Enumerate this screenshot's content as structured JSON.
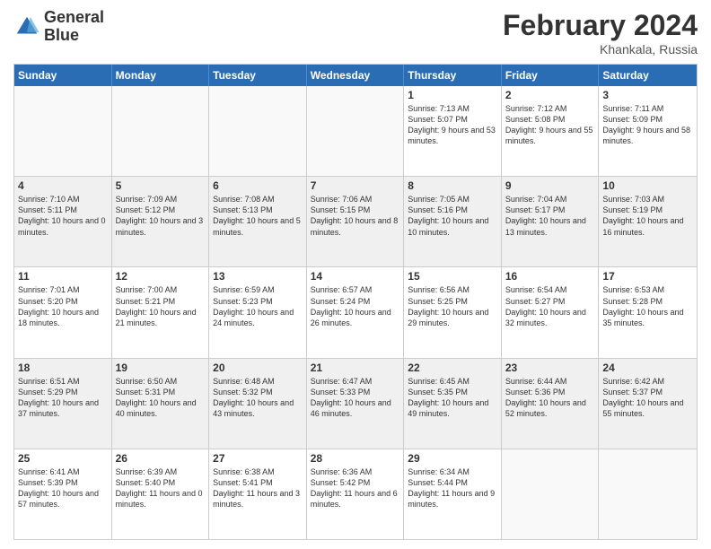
{
  "logo": {
    "line1": "General",
    "line2": "Blue"
  },
  "title": "February 2024",
  "location": "Khankala, Russia",
  "days_of_week": [
    "Sunday",
    "Monday",
    "Tuesday",
    "Wednesday",
    "Thursday",
    "Friday",
    "Saturday"
  ],
  "rows": [
    {
      "shaded": false,
      "cells": [
        {
          "day": "",
          "sunrise": "",
          "sunset": "",
          "daylight": "",
          "empty": true
        },
        {
          "day": "",
          "sunrise": "",
          "sunset": "",
          "daylight": "",
          "empty": true
        },
        {
          "day": "",
          "sunrise": "",
          "sunset": "",
          "daylight": "",
          "empty": true
        },
        {
          "day": "",
          "sunrise": "",
          "sunset": "",
          "daylight": "",
          "empty": true
        },
        {
          "day": "1",
          "sunrise": "Sunrise: 7:13 AM",
          "sunset": "Sunset: 5:07 PM",
          "daylight": "Daylight: 9 hours and 53 minutes.",
          "empty": false
        },
        {
          "day": "2",
          "sunrise": "Sunrise: 7:12 AM",
          "sunset": "Sunset: 5:08 PM",
          "daylight": "Daylight: 9 hours and 55 minutes.",
          "empty": false
        },
        {
          "day": "3",
          "sunrise": "Sunrise: 7:11 AM",
          "sunset": "Sunset: 5:09 PM",
          "daylight": "Daylight: 9 hours and 58 minutes.",
          "empty": false
        }
      ]
    },
    {
      "shaded": true,
      "cells": [
        {
          "day": "4",
          "sunrise": "Sunrise: 7:10 AM",
          "sunset": "Sunset: 5:11 PM",
          "daylight": "Daylight: 10 hours and 0 minutes.",
          "empty": false
        },
        {
          "day": "5",
          "sunrise": "Sunrise: 7:09 AM",
          "sunset": "Sunset: 5:12 PM",
          "daylight": "Daylight: 10 hours and 3 minutes.",
          "empty": false
        },
        {
          "day": "6",
          "sunrise": "Sunrise: 7:08 AM",
          "sunset": "Sunset: 5:13 PM",
          "daylight": "Daylight: 10 hours and 5 minutes.",
          "empty": false
        },
        {
          "day": "7",
          "sunrise": "Sunrise: 7:06 AM",
          "sunset": "Sunset: 5:15 PM",
          "daylight": "Daylight: 10 hours and 8 minutes.",
          "empty": false
        },
        {
          "day": "8",
          "sunrise": "Sunrise: 7:05 AM",
          "sunset": "Sunset: 5:16 PM",
          "daylight": "Daylight: 10 hours and 10 minutes.",
          "empty": false
        },
        {
          "day": "9",
          "sunrise": "Sunrise: 7:04 AM",
          "sunset": "Sunset: 5:17 PM",
          "daylight": "Daylight: 10 hours and 13 minutes.",
          "empty": false
        },
        {
          "day": "10",
          "sunrise": "Sunrise: 7:03 AM",
          "sunset": "Sunset: 5:19 PM",
          "daylight": "Daylight: 10 hours and 16 minutes.",
          "empty": false
        }
      ]
    },
    {
      "shaded": false,
      "cells": [
        {
          "day": "11",
          "sunrise": "Sunrise: 7:01 AM",
          "sunset": "Sunset: 5:20 PM",
          "daylight": "Daylight: 10 hours and 18 minutes.",
          "empty": false
        },
        {
          "day": "12",
          "sunrise": "Sunrise: 7:00 AM",
          "sunset": "Sunset: 5:21 PM",
          "daylight": "Daylight: 10 hours and 21 minutes.",
          "empty": false
        },
        {
          "day": "13",
          "sunrise": "Sunrise: 6:59 AM",
          "sunset": "Sunset: 5:23 PM",
          "daylight": "Daylight: 10 hours and 24 minutes.",
          "empty": false
        },
        {
          "day": "14",
          "sunrise": "Sunrise: 6:57 AM",
          "sunset": "Sunset: 5:24 PM",
          "daylight": "Daylight: 10 hours and 26 minutes.",
          "empty": false
        },
        {
          "day": "15",
          "sunrise": "Sunrise: 6:56 AM",
          "sunset": "Sunset: 5:25 PM",
          "daylight": "Daylight: 10 hours and 29 minutes.",
          "empty": false
        },
        {
          "day": "16",
          "sunrise": "Sunrise: 6:54 AM",
          "sunset": "Sunset: 5:27 PM",
          "daylight": "Daylight: 10 hours and 32 minutes.",
          "empty": false
        },
        {
          "day": "17",
          "sunrise": "Sunrise: 6:53 AM",
          "sunset": "Sunset: 5:28 PM",
          "daylight": "Daylight: 10 hours and 35 minutes.",
          "empty": false
        }
      ]
    },
    {
      "shaded": true,
      "cells": [
        {
          "day": "18",
          "sunrise": "Sunrise: 6:51 AM",
          "sunset": "Sunset: 5:29 PM",
          "daylight": "Daylight: 10 hours and 37 minutes.",
          "empty": false
        },
        {
          "day": "19",
          "sunrise": "Sunrise: 6:50 AM",
          "sunset": "Sunset: 5:31 PM",
          "daylight": "Daylight: 10 hours and 40 minutes.",
          "empty": false
        },
        {
          "day": "20",
          "sunrise": "Sunrise: 6:48 AM",
          "sunset": "Sunset: 5:32 PM",
          "daylight": "Daylight: 10 hours and 43 minutes.",
          "empty": false
        },
        {
          "day": "21",
          "sunrise": "Sunrise: 6:47 AM",
          "sunset": "Sunset: 5:33 PM",
          "daylight": "Daylight: 10 hours and 46 minutes.",
          "empty": false
        },
        {
          "day": "22",
          "sunrise": "Sunrise: 6:45 AM",
          "sunset": "Sunset: 5:35 PM",
          "daylight": "Daylight: 10 hours and 49 minutes.",
          "empty": false
        },
        {
          "day": "23",
          "sunrise": "Sunrise: 6:44 AM",
          "sunset": "Sunset: 5:36 PM",
          "daylight": "Daylight: 10 hours and 52 minutes.",
          "empty": false
        },
        {
          "day": "24",
          "sunrise": "Sunrise: 6:42 AM",
          "sunset": "Sunset: 5:37 PM",
          "daylight": "Daylight: 10 hours and 55 minutes.",
          "empty": false
        }
      ]
    },
    {
      "shaded": false,
      "cells": [
        {
          "day": "25",
          "sunrise": "Sunrise: 6:41 AM",
          "sunset": "Sunset: 5:39 PM",
          "daylight": "Daylight: 10 hours and 57 minutes.",
          "empty": false
        },
        {
          "day": "26",
          "sunrise": "Sunrise: 6:39 AM",
          "sunset": "Sunset: 5:40 PM",
          "daylight": "Daylight: 11 hours and 0 minutes.",
          "empty": false
        },
        {
          "day": "27",
          "sunrise": "Sunrise: 6:38 AM",
          "sunset": "Sunset: 5:41 PM",
          "daylight": "Daylight: 11 hours and 3 minutes.",
          "empty": false
        },
        {
          "day": "28",
          "sunrise": "Sunrise: 6:36 AM",
          "sunset": "Sunset: 5:42 PM",
          "daylight": "Daylight: 11 hours and 6 minutes.",
          "empty": false
        },
        {
          "day": "29",
          "sunrise": "Sunrise: 6:34 AM",
          "sunset": "Sunset: 5:44 PM",
          "daylight": "Daylight: 11 hours and 9 minutes.",
          "empty": false
        },
        {
          "day": "",
          "sunrise": "",
          "sunset": "",
          "daylight": "",
          "empty": true
        },
        {
          "day": "",
          "sunrise": "",
          "sunset": "",
          "daylight": "",
          "empty": true
        }
      ]
    }
  ]
}
